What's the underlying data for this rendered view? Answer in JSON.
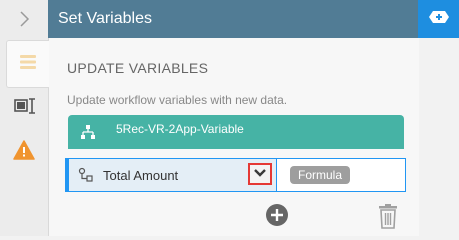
{
  "header": {
    "title": "Set Variables"
  },
  "section": {
    "title": "UPDATE VARIABLES",
    "description": "Update workflow variables with new data."
  },
  "variable_bar": {
    "label": "5Rec-VR-2App-Variable"
  },
  "row": {
    "variable_name": "Total Amount",
    "value_type": "Formula"
  },
  "rail": {
    "icons": [
      "chevron-right-icon",
      "list-icon",
      "text-cursor-icon",
      "warning-icon"
    ]
  },
  "colors": {
    "header": "#517c95",
    "header_strip": "#1e8ee0",
    "variable_bar": "#46b3a5",
    "row_border": "#2196f3",
    "dropdown_highlight": "#e53935",
    "warning": "#f0942f"
  }
}
